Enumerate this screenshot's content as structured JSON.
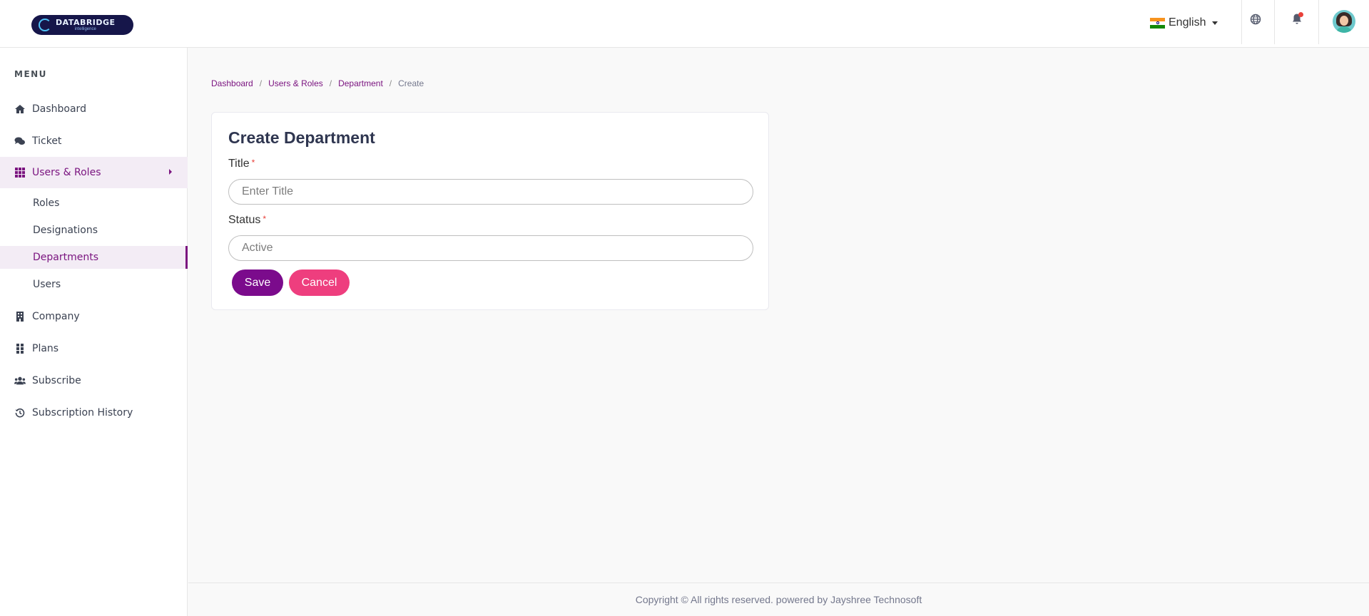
{
  "header": {
    "logo_text": "DATABRIDGE",
    "logo_subtext": "intelligence",
    "language": "English",
    "icons": [
      "globe-icon",
      "bell-icon",
      "avatar"
    ]
  },
  "sidebar": {
    "menu_title": "MENU",
    "items": [
      {
        "label": "Dashboard",
        "icon": "home-icon"
      },
      {
        "label": "Ticket",
        "icon": "comments-icon"
      },
      {
        "label": "Users & Roles",
        "icon": "grid-icon",
        "active": true
      },
      {
        "label": "Company",
        "icon": "building-icon"
      },
      {
        "label": "Plans",
        "icon": "dots-grid-icon"
      },
      {
        "label": "Subscribe",
        "icon": "users-icon"
      },
      {
        "label": "Subscription History",
        "icon": "history-icon"
      }
    ],
    "sub_items": [
      {
        "label": "Roles"
      },
      {
        "label": "Designations"
      },
      {
        "label": "Departments",
        "active": true
      },
      {
        "label": "Users"
      }
    ]
  },
  "breadcrumb": {
    "items": [
      "Dashboard",
      "Users & Roles",
      "Department"
    ],
    "current": "Create",
    "separator": "/"
  },
  "form": {
    "title": "Create Department",
    "title_label": "Title",
    "title_placeholder": "Enter Title",
    "status_label": "Status",
    "status_value": "Active",
    "required_mark": "*",
    "save_label": "Save",
    "cancel_label": "Cancel"
  },
  "footer": {
    "text": "Copyright © All rights reserved. powered by Jayshree Technosoft"
  },
  "colors": {
    "accent": "#7b1580",
    "save_button": "#7b0b8c",
    "cancel_button": "#ee3e7e",
    "active_bg": "#f3ecf5"
  }
}
